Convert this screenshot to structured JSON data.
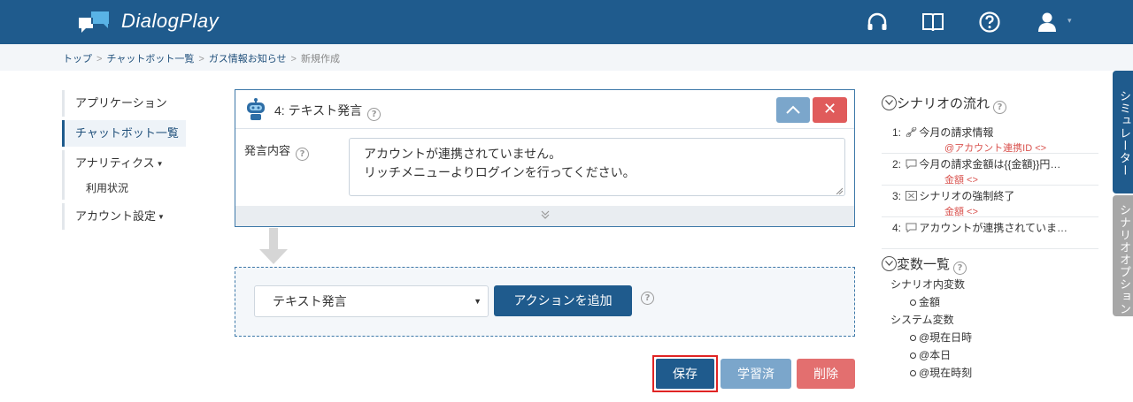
{
  "header": {
    "brand": "DialogPlay",
    "icons": [
      "headset-icon",
      "book-icon",
      "help-icon",
      "user-icon"
    ]
  },
  "breadcrumb": {
    "items": [
      "トップ",
      "チャットボット一覧",
      "ガス情報お知らせ"
    ],
    "current": "新規作成"
  },
  "sidebar": {
    "items": [
      {
        "label": "アプリケーション"
      },
      {
        "label": "チャットボット一覧"
      },
      {
        "label": "アナリティクス"
      },
      {
        "label": "利用状況"
      },
      {
        "label": "アカウント設定"
      }
    ]
  },
  "card": {
    "title": "4: テキスト発言",
    "field_label": "発言内容",
    "message": "アカウントが連携されていません。\nリッチメニューよりログインを行ってください。"
  },
  "add_action": {
    "selected": "テキスト発言",
    "button": "アクションを追加"
  },
  "buttons": {
    "save": "保存",
    "learned": "学習済",
    "delete": "削除"
  },
  "scenario_flow": {
    "title": "シナリオの流れ",
    "items": [
      {
        "num": "1:",
        "icon": "link-icon",
        "text": "今月の請求情報",
        "sub": "@アカウント連携ID <>"
      },
      {
        "num": "2:",
        "icon": "speech-bubble-icon",
        "text": "今月の請求金額は{{金額}}円…",
        "sub": "金額 <>"
      },
      {
        "num": "3:",
        "icon": "stop-icon",
        "text": "シナリオの強制終了",
        "sub": "金額 <>"
      },
      {
        "num": "4:",
        "icon": "speech-bubble-icon",
        "text": "アカウントが連携されていま…",
        "sub": ""
      }
    ]
  },
  "variables": {
    "title": "変数一覧",
    "scenario_label": "シナリオ内変数",
    "scenario_vars": [
      "金額"
    ],
    "system_label": "システム変数",
    "system_vars": [
      "@現在日時",
      "@本日",
      "@現在時刻"
    ]
  },
  "side_tabs": {
    "simulator": "シミュレーター",
    "options": "シナリオオプション"
  },
  "colors": {
    "primary": "#1f5b8d",
    "secondary": "#7ba6cb",
    "danger": "#e05b5b",
    "highlight": "#e02424"
  }
}
